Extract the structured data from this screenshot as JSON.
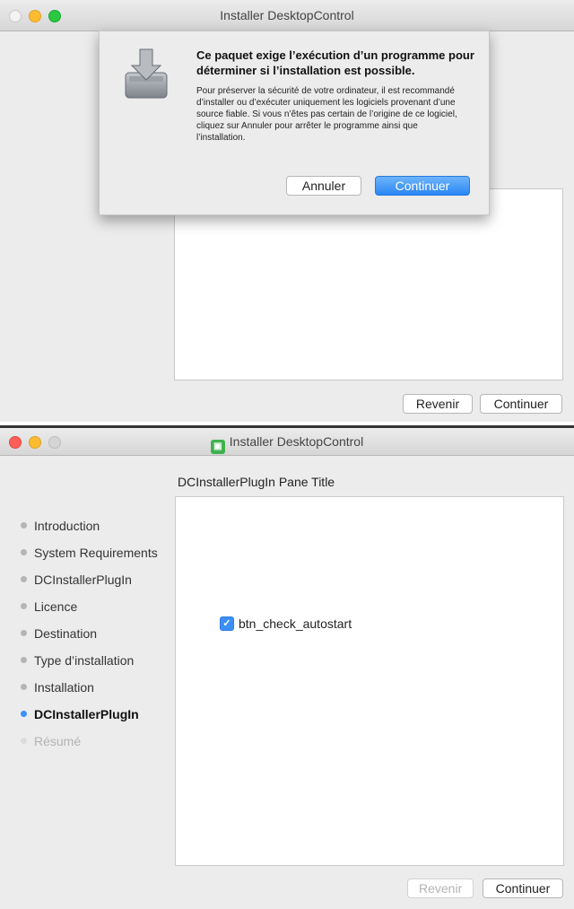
{
  "window1": {
    "title": "Installer DesktopControl",
    "buttons": {
      "back": "Revenir",
      "continue": "Continuer"
    },
    "dialog": {
      "heading": "Ce paquet exige l’exécution d’un programme pour déterminer si l’installation est possible.",
      "body": "Pour préserver la sécurité de votre ordinateur, il est recommandé d’installer ou d’exécuter uniquement les logiciels provenant d’une source fiable. Si vous n’êtes pas certain de l’origine de ce logiciel, cliquez sur Annuler pour arrêter le programme ainsi que l’installation.",
      "cancel_label": "Annuler",
      "continue_label": "Continuer"
    }
  },
  "window2": {
    "title": "Installer DesktopControl",
    "pane_title": "DCInstallerPlugIn Pane Title",
    "sidebar": [
      {
        "label": "Introduction",
        "state": "done"
      },
      {
        "label": "System Requirements",
        "state": "done"
      },
      {
        "label": "DCInstallerPlugIn",
        "state": "done"
      },
      {
        "label": "Licence",
        "state": "done"
      },
      {
        "label": "Destination",
        "state": "done"
      },
      {
        "label": "Type d’installation",
        "state": "done"
      },
      {
        "label": "Installation",
        "state": "done"
      },
      {
        "label": "DCInstallerPlugIn",
        "state": "active"
      },
      {
        "label": "Résumé",
        "state": "disabled"
      }
    ],
    "checkbox": {
      "label": "btn_check_autostart",
      "checked": true
    },
    "buttons": {
      "back": "Revenir",
      "continue": "Continuer"
    }
  },
  "icons": {
    "window2_app_icon": "app-icon",
    "dialog_icon": "package-download-icon"
  },
  "colors": {
    "accent": "#3d8ff5",
    "primary_button": "#2a86f4"
  }
}
